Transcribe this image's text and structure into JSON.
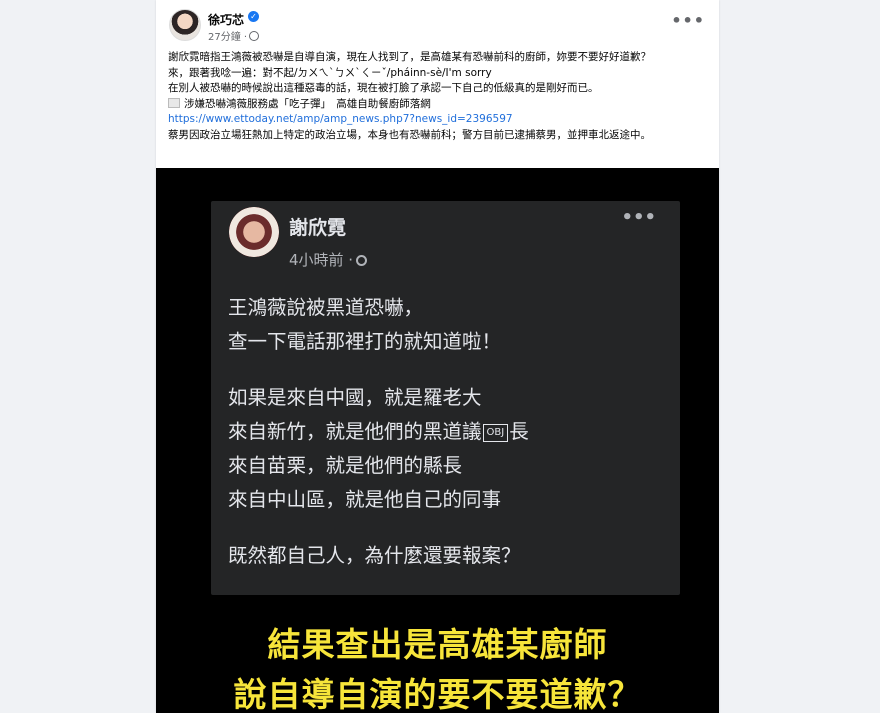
{
  "post": {
    "author": "徐巧芯",
    "time": "27分鐘 ·",
    "more_label": "•••",
    "text_lines": [
      "謝欣霓暗指王鴻薇被恐嚇是自導自演，現在人找到了，是高雄某有恐嚇前科的廚師，妳要不要好好道歉？",
      "來，跟著我唸一遍：對不起/ㄉㄨㄟˋㄅㄨˋㄑㄧˇ/pháinn-sè/I'm sorry",
      "在別人被恐嚇的時候說出這種惡毒的話，現在被打臉了承認一下自己的低級真的是剛好而已。",
      "涉嫌恐嚇鴻薇服務處「吃子彈」　高雄自助餐廚師落網"
    ],
    "link": "https://www.ettoday.net/amp/amp_news.php7?news_id=2396597",
    "last_line": "蔡男因政治立場狂熱加上特定的政治立場，本身也有恐嚇前科；警方目前已逮捕蔡男，並押車北返途中。"
  },
  "video": {
    "card": {
      "name": "謝欣霓",
      "time": "4小時前 ·",
      "more_label": "•••",
      "line1": "王鴻薇說被黑道恐嚇，",
      "line2": "查一下電話那裡打的就知道啦！",
      "line3": "如果是來自中國，就是羅老大",
      "line4a": "來自新竹，就是他們的黑道議",
      "obj": "OBJ",
      "line4b": "長",
      "line5": "來自苗栗，就是他們的縣長",
      "line6": "來自中山區，就是他自己的同事",
      "line7": "既然都自己人，為什麼還要報案？"
    },
    "caption1": "結果查出是高雄某廚師",
    "caption2": "說自導自演的要不要道歉？"
  }
}
